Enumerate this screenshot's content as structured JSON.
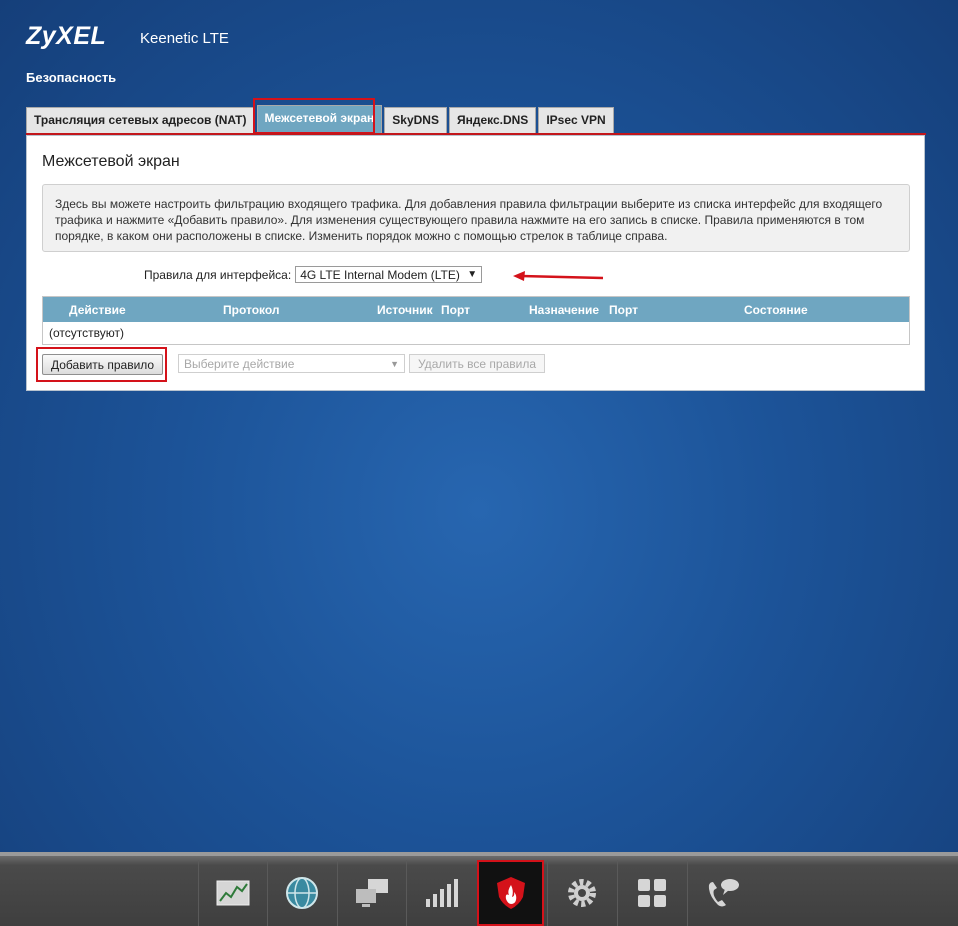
{
  "header": {
    "brand": "ZyXEL",
    "model": "Keenetic LTE",
    "section": "Безопасность"
  },
  "tabs": [
    {
      "label": "Трансляция сетевых адресов (NAT)",
      "active": false
    },
    {
      "label": "Межсетевой экран",
      "active": true
    },
    {
      "label": "SkyDNS",
      "active": false
    },
    {
      "label": "Яндекс.DNS",
      "active": false
    },
    {
      "label": "IPsec VPN",
      "active": false
    }
  ],
  "panel": {
    "title": "Межсетевой экран",
    "info": "Здесь вы можете настроить фильтрацию входящего трафика. Для добавления правила фильтрации выберите из списка интерфейс для входящего трафика и нажмите «Добавить правило». Для изменения существующего правила нажмите на его запись в списке. Правила применяются в том порядке, в каком они расположены в списке. Изменить порядок можно с помощью стрелок в таблице справа.",
    "interface_label": "Правила для интерфейса:",
    "interface_value": "4G LTE Internal Modem (LTE)",
    "table": {
      "columns": [
        "Действие",
        "Протокол",
        "Источник",
        "Порт",
        "Назначение",
        "Порт",
        "Состояние"
      ],
      "empty_text": "(отсутствуют)"
    },
    "add_button": "Добавить правило",
    "action_placeholder": "Выберите действие",
    "delete_all_button": "Удалить все правила"
  },
  "dock": [
    {
      "icon": "monitor-chart-icon",
      "active": false
    },
    {
      "icon": "globe-icon",
      "active": false
    },
    {
      "icon": "network-computers-icon",
      "active": false
    },
    {
      "icon": "signal-bars-icon",
      "active": false
    },
    {
      "icon": "firewall-shield-icon",
      "active": true
    },
    {
      "icon": "gear-icon",
      "active": false
    },
    {
      "icon": "apps-grid-icon",
      "active": false
    },
    {
      "icon": "phone-chat-icon",
      "active": false
    }
  ],
  "colors": {
    "accent": "#6fa6c1",
    "highlight": "#d4121a",
    "background": "#1c5398"
  }
}
